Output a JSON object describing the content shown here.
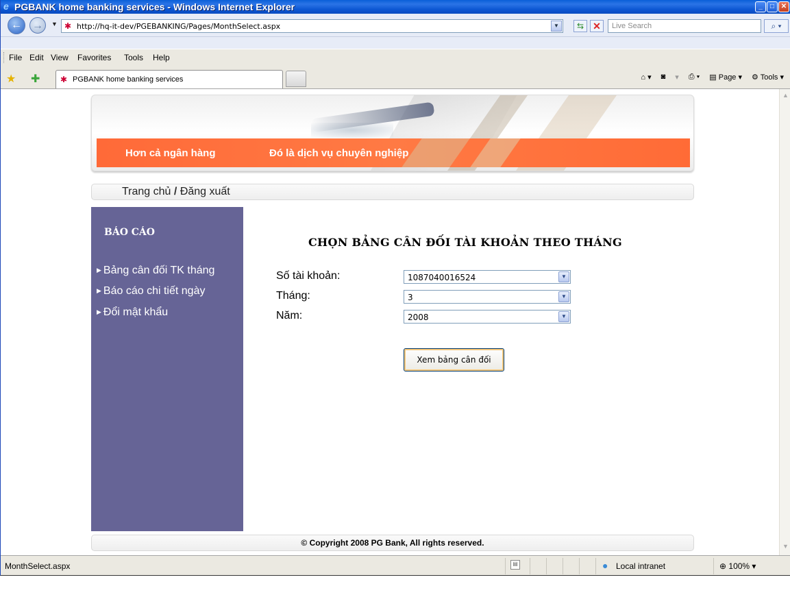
{
  "window": {
    "title": "PGBANK home banking services - Windows Internet Explorer"
  },
  "address": {
    "url": "http://hq-it-dev/PGEBANKING/Pages/MonthSelect.aspx",
    "search_placeholder": "Live Search"
  },
  "menu": {
    "items": [
      "File",
      "Edit",
      "View",
      "Favorites",
      "Tools",
      "Help"
    ]
  },
  "tab": {
    "label": "PGBANK home banking services"
  },
  "toolbar": {
    "page_label": "Page",
    "tools_label": "Tools"
  },
  "banner": {
    "tagline1": "Hơn cả ngân hàng",
    "tagline2": "Đó là dịch vụ chuyên nghiệp"
  },
  "breadcrumb": {
    "home": "Trang chủ",
    "separator": "/",
    "logout": "Đăng xuất"
  },
  "sidebar": {
    "heading": "BÁO CÁO",
    "items": [
      {
        "label": "Bảng cân đối TK tháng"
      },
      {
        "label": "Báo cáo chi tiết ngày"
      },
      {
        "label": "Đổi mật khẩu"
      }
    ]
  },
  "main": {
    "heading": "CHỌN BẢNG CÂN ĐỐI TÀI KHOẢN THEO THÁNG",
    "account_label": "Số tài khoản:",
    "account_value": "1087040016524",
    "month_label": "Tháng:",
    "month_value": "3",
    "year_label": "Năm:",
    "year_value": "2008",
    "submit_label": "Xem bảng cân đối"
  },
  "footer": {
    "copyright": "© Copyright 2008 PG Bank, All rights reserved."
  },
  "status": {
    "text": "MonthSelect.aspx",
    "zone": "Local intranet",
    "zoom": "100%"
  },
  "colors": {
    "sidebar_bg": "#666496",
    "banner_stripe": "#ff6a38",
    "titlebar": "#0a5fd8"
  }
}
